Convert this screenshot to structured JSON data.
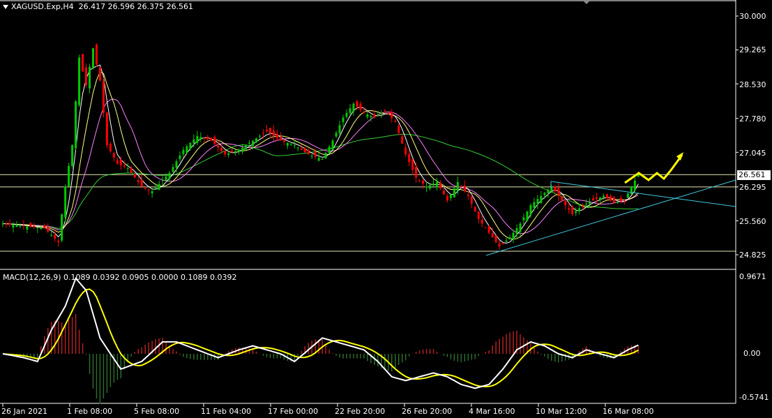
{
  "header": {
    "symbol": "XAGUSD.Exp,H4",
    "ohlc": "26.417 26.596 26.375 26.561"
  },
  "macd_header": {
    "label": "MACD(12,26,9)",
    "values": "0.1089 0.0392 0.0905 0.0000 0.1089 0.0392"
  },
  "price_axis": [
    "30.000",
    "29.265",
    "28.530",
    "27.780",
    "27.045",
    "26.295",
    "25.560",
    "24.825"
  ],
  "current_price": "26.561",
  "macd_axis": [
    "0.9671",
    "0.00",
    "-0.5741"
  ],
  "time_axis": [
    "26 Jan 2021",
    "1 Feb 08:00",
    "5 Feb 08:00",
    "11 Feb 04:00",
    "17 Feb 00:00",
    "22 Feb 20:00",
    "26 Feb 20:00",
    "4 Mar 16:00",
    "10 Mar 12:00",
    "16 Mar 08:00"
  ],
  "colors": {
    "bull": "#00c800",
    "bear": "#ff0000",
    "ma_fast": "#ffffff",
    "ma_slow": "#ffff80",
    "ma_mid": "#ff80ff",
    "ma_long": "#33cc33",
    "trendline": "#40c8e0",
    "hline": "#e6e6b0",
    "macd_line": "#ffffff",
    "signal_line": "#ffff00",
    "projection": "#ffff00"
  },
  "chart_data": {
    "type": "candlestick",
    "symbol": "XAGUSD",
    "timeframe": "H4",
    "ylim": [
      24.6,
      30.3
    ],
    "horizontal_levels": [
      26.561,
      26.295,
      24.9
    ],
    "price_keypoints": [
      [
        0,
        25.5
      ],
      [
        12,
        25.4
      ],
      [
        16,
        25.1
      ],
      [
        18,
        26.3
      ],
      [
        20,
        27.2
      ],
      [
        22,
        29.1
      ],
      [
        24,
        28.5
      ],
      [
        26,
        29.3
      ],
      [
        28,
        28.6
      ],
      [
        30,
        27.2
      ],
      [
        33,
        26.8
      ],
      [
        36,
        26.7
      ],
      [
        40,
        26.3
      ],
      [
        43,
        26.2
      ],
      [
        48,
        26.6
      ],
      [
        52,
        27.1
      ],
      [
        56,
        27.4
      ],
      [
        60,
        27.3
      ],
      [
        64,
        27.0
      ],
      [
        68,
        27.1
      ],
      [
        72,
        27.3
      ],
      [
        76,
        27.5
      ],
      [
        80,
        27.3
      ],
      [
        84,
        27.2
      ],
      [
        88,
        27.0
      ],
      [
        92,
        26.9
      ],
      [
        95,
        27.3
      ],
      [
        98,
        27.8
      ],
      [
        101,
        28.1
      ],
      [
        104,
        27.9
      ],
      [
        107,
        27.8
      ],
      [
        110,
        27.95
      ],
      [
        113,
        27.7
      ],
      [
        116,
        27.0
      ],
      [
        119,
        26.5
      ],
      [
        122,
        26.3
      ],
      [
        125,
        26.4
      ],
      [
        128,
        26.0
      ],
      [
        131,
        26.4
      ],
      [
        134,
        26.1
      ],
      [
        137,
        25.6
      ],
      [
        140,
        25.3
      ],
      [
        143,
        25.0
      ],
      [
        146,
        25.2
      ],
      [
        149,
        25.5
      ],
      [
        152,
        25.9
      ],
      [
        155,
        26.1
      ],
      [
        158,
        26.3
      ],
      [
        161,
        26.0
      ],
      [
        164,
        25.7
      ],
      [
        167,
        25.9
      ],
      [
        170,
        26.0
      ],
      [
        173,
        26.1
      ],
      [
        176,
        25.95
      ],
      [
        179,
        26.0
      ],
      [
        181,
        26.3
      ],
      [
        183,
        26.56
      ]
    ],
    "macd_series": [
      [
        0,
        0.0
      ],
      [
        6,
        -0.05
      ],
      [
        10,
        -0.1
      ],
      [
        14,
        0.3
      ],
      [
        18,
        0.6
      ],
      [
        21,
        0.95
      ],
      [
        24,
        0.8
      ],
      [
        28,
        0.2
      ],
      [
        34,
        -0.2
      ],
      [
        40,
        -0.1
      ],
      [
        46,
        0.15
      ],
      [
        50,
        0.15
      ],
      [
        56,
        0.05
      ],
      [
        62,
        -0.05
      ],
      [
        68,
        0.05
      ],
      [
        72,
        0.1
      ],
      [
        76,
        0.05
      ],
      [
        80,
        0.0
      ],
      [
        84,
        -0.1
      ],
      [
        88,
        0.05
      ],
      [
        92,
        0.2
      ],
      [
        96,
        0.15
      ],
      [
        100,
        0.1
      ],
      [
        104,
        0.05
      ],
      [
        108,
        -0.1
      ],
      [
        112,
        -0.3
      ],
      [
        116,
        -0.35
      ],
      [
        120,
        -0.3
      ],
      [
        124,
        -0.25
      ],
      [
        128,
        -0.3
      ],
      [
        132,
        -0.4
      ],
      [
        136,
        -0.45
      ],
      [
        140,
        -0.4
      ],
      [
        144,
        -0.2
      ],
      [
        148,
        0.05
      ],
      [
        152,
        0.15
      ],
      [
        156,
        0.1
      ],
      [
        160,
        0.0
      ],
      [
        164,
        -0.05
      ],
      [
        168,
        0.05
      ],
      [
        172,
        0.0
      ],
      [
        176,
        -0.05
      ],
      [
        180,
        0.05
      ],
      [
        183,
        0.11
      ]
    ],
    "projection": "zigzag upward from 26.56 toward ~27.0"
  }
}
